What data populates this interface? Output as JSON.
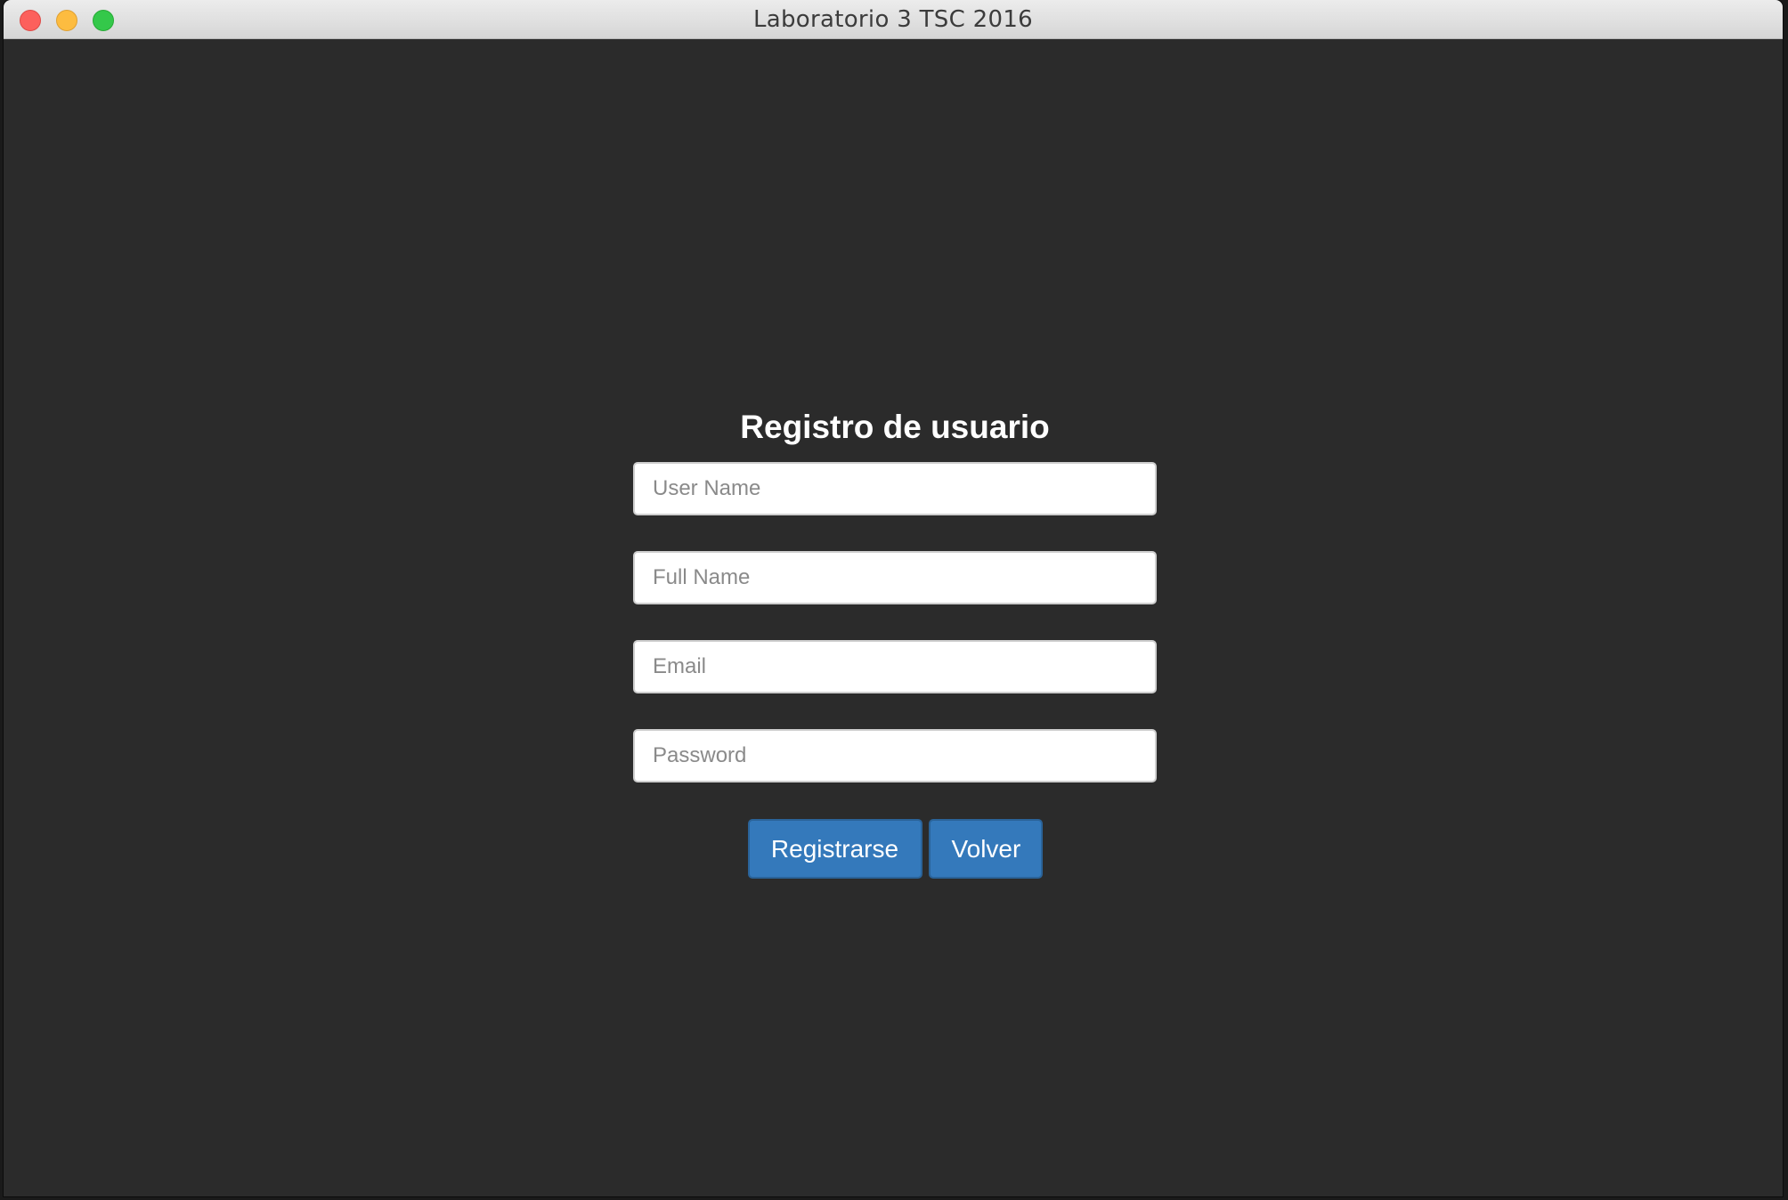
{
  "window": {
    "title": "Laboratorio 3 TSC 2016"
  },
  "form": {
    "title": "Registro de usuario",
    "fields": [
      {
        "name": "username",
        "placeholder": "User Name",
        "value": ""
      },
      {
        "name": "fullname",
        "placeholder": "Full Name",
        "value": ""
      },
      {
        "name": "email",
        "placeholder": "Email",
        "value": ""
      },
      {
        "name": "password",
        "placeholder": "Password",
        "value": ""
      }
    ],
    "buttons": {
      "register_label": "Registrarse",
      "back_label": "Volver"
    }
  },
  "colors": {
    "background": "#2b2b2b",
    "button_primary": "#3479bb",
    "close": "#fc605c",
    "minimize": "#fdbc40",
    "maximize": "#34c84a"
  }
}
